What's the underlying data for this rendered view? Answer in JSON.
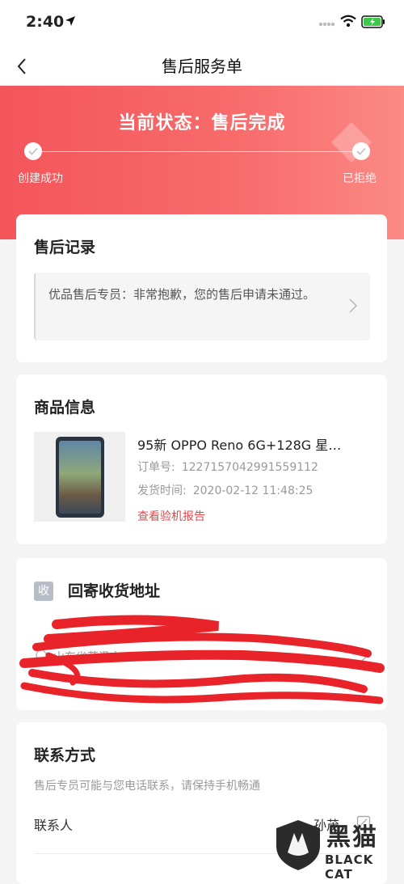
{
  "status_bar": {
    "time": "2:40"
  },
  "nav": {
    "title": "售后服务单"
  },
  "status": {
    "title": "当前状态：售后完成",
    "steps": [
      {
        "label": "创建成功"
      },
      {
        "label": "已拒绝"
      }
    ]
  },
  "record": {
    "title": "售后记录",
    "message": "优品售后专员：非常抱歉，您的售后申请未通过。"
  },
  "goods": {
    "title": "商品信息",
    "name": "95新 OPPO Reno 6G+128G 星…",
    "order_label": "订单号:",
    "order_no": "1227157042991559112",
    "ship_label": "发货时间:",
    "ship_time": "2020-02-12 11:48:25",
    "report_link": "查看验机报告"
  },
  "address": {
    "badge": "收",
    "title": "回寄收货地址",
    "text_partial": "山东省菏泽市"
  },
  "contact": {
    "title": "联系方式",
    "subtitle": "售后专员可能与您电话联系，请保持手机畅通",
    "person_label": "联系人",
    "person_value": "孙茂"
  },
  "watermark": {
    "cn": "黑猫",
    "en": "BLACK CAT"
  },
  "colors": {
    "accent": "#f3555a",
    "link": "#e64a4a",
    "scribble": "#e8232a"
  }
}
